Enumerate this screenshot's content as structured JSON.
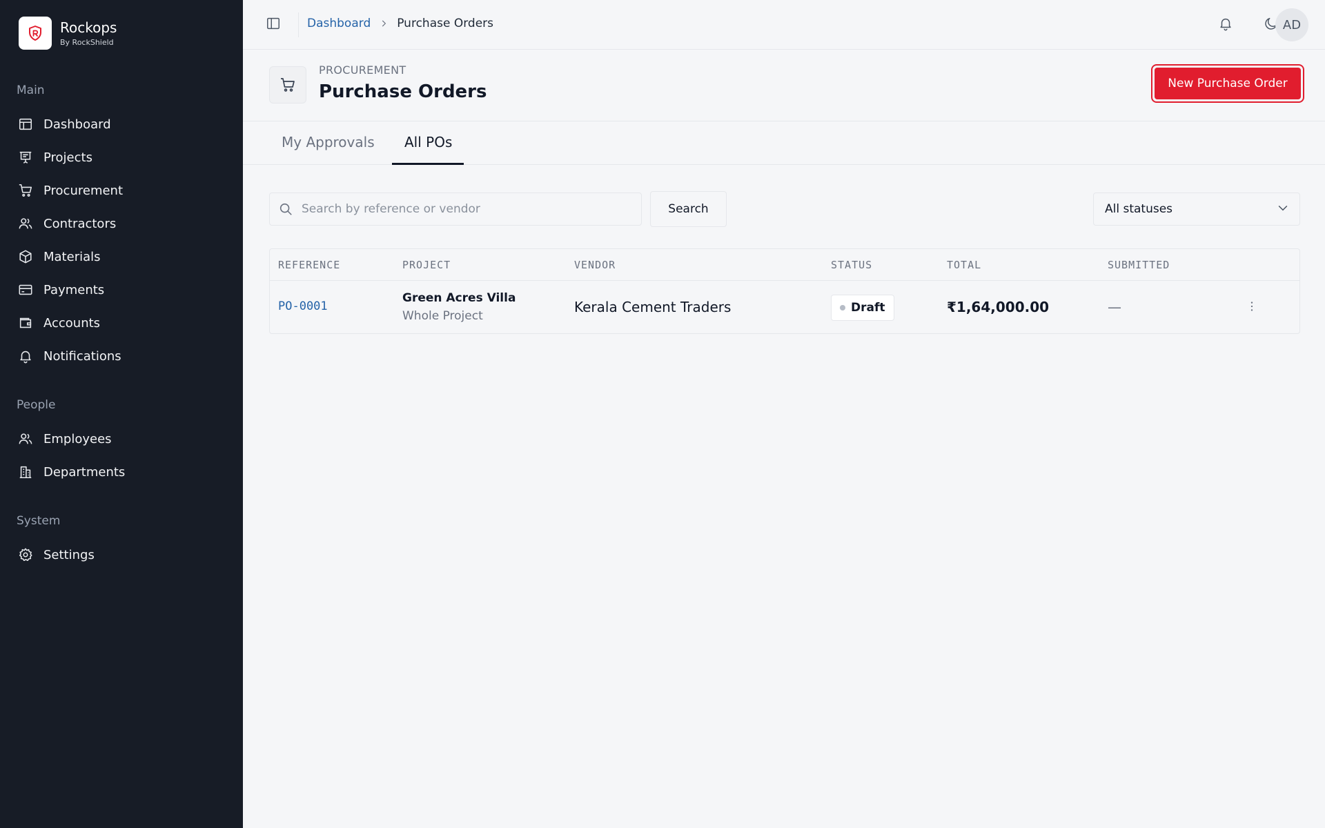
{
  "brand": {
    "name": "Rockops",
    "sub": "By RockShield",
    "logo_icon": "shield-logo-icon",
    "accent": "#e11d2e"
  },
  "sidebar": {
    "sections": [
      {
        "label": "Main"
      },
      {
        "label": "People"
      },
      {
        "label": "System"
      }
    ],
    "items": [
      {
        "label": "Dashboard",
        "icon": "layout-dashboard-icon"
      },
      {
        "label": "Projects",
        "icon": "projects-icon"
      },
      {
        "label": "Procurement",
        "icon": "cart-icon"
      },
      {
        "label": "Contractors",
        "icon": "users-icon"
      },
      {
        "label": "Materials",
        "icon": "box-icon"
      },
      {
        "label": "Payments",
        "icon": "credit-card-icon"
      },
      {
        "label": "Accounts",
        "icon": "wallet-icon"
      },
      {
        "label": "Notifications",
        "icon": "bell-icon"
      },
      {
        "label": "Employees",
        "icon": "users-icon"
      },
      {
        "label": "Departments",
        "icon": "building-icon"
      },
      {
        "label": "Settings",
        "icon": "gear-icon"
      }
    ]
  },
  "topbar": {
    "breadcrumb": {
      "root": "Dashboard",
      "current": "Purchase Orders"
    },
    "avatar_initials": "AD"
  },
  "header": {
    "eyebrow": "PROCUREMENT",
    "title": "Purchase Orders",
    "primary_button": "New Purchase Order"
  },
  "tabs": [
    {
      "label": "My Approvals",
      "active": false
    },
    {
      "label": "All POs",
      "active": true
    }
  ],
  "filters": {
    "search_placeholder": "Search by reference or vendor",
    "search_value": "",
    "search_button": "Search",
    "status_selected": "All statuses"
  },
  "table": {
    "columns": [
      "REFERENCE",
      "PROJECT",
      "VENDOR",
      "STATUS",
      "TOTAL",
      "SUBMITTED"
    ],
    "rows": [
      {
        "reference": "PO-0001",
        "project_name": "Green Acres Villa",
        "project_scope": "Whole Project",
        "vendor": "Kerala Cement Traders",
        "status": "Draft",
        "total": "₹1,64,000.00",
        "submitted": "—"
      }
    ]
  }
}
